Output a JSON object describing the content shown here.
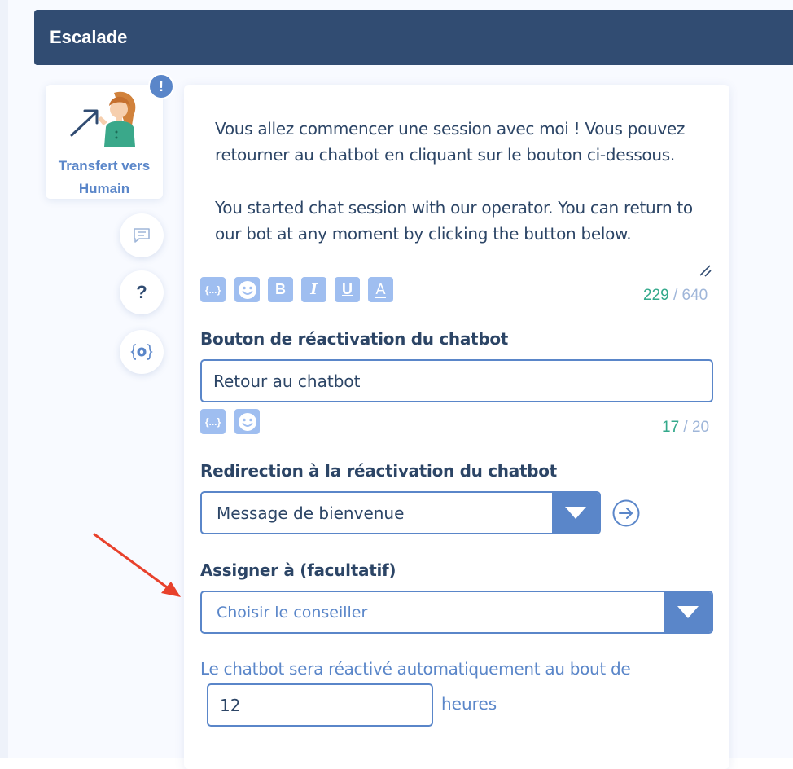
{
  "header": {
    "title": "Escalade"
  },
  "node": {
    "label_line1": "Transfert vers",
    "label_line2": "Humain",
    "badge": "!",
    "illustration": "person-with-arrow"
  },
  "side_buttons": [
    {
      "icon": "chat-bubble-icon"
    },
    {
      "icon": "question-icon",
      "glyph": "?"
    },
    {
      "icon": "settings-variable-icon"
    }
  ],
  "message": {
    "paragraph_fr": "Vous allez commencer une session avec moi ! Vous pouvez retourner au chatbot en cliquant sur le bouton ci-dessous.",
    "paragraph_en": "You started chat session with our operator. You can return to our bot at any moment by clicking the button below.",
    "counter_current": "229",
    "counter_max": "/ 640"
  },
  "toolbar": {
    "variable_glyph": "{...}",
    "bold_glyph": "B",
    "italic_glyph": "I",
    "underline_glyph": "U",
    "text_color_glyph": "A"
  },
  "reactivation_button": {
    "label": "Bouton de réactivation du chatbot",
    "value": "Retour au chatbot",
    "counter_current": "17",
    "counter_max": "/ 20"
  },
  "redirection": {
    "label": "Redirection à la réactivation du chatbot",
    "selected": "Message de bienvenue"
  },
  "assign": {
    "label": "Assigner à (facultatif)",
    "placeholder": "Choisir le conseiller"
  },
  "auto_reactivation": {
    "text": "Le chatbot sera réactivé automatiquement au bout de",
    "value": "12",
    "unit": "heures"
  },
  "colors": {
    "header_bg": "#314c72",
    "accent": "#5a86c9",
    "toolbar_button": "#9fbef0",
    "counter_current": "#33a98b",
    "annotation_arrow": "#e8412c"
  }
}
